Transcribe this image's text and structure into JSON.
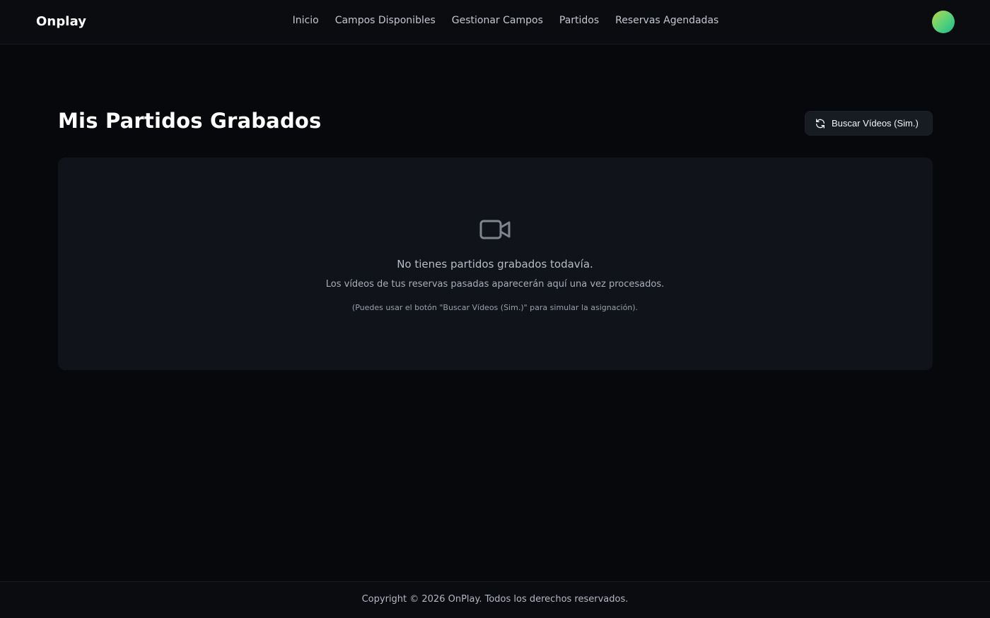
{
  "header": {
    "brand": "Onplay",
    "nav": [
      {
        "label": "Inicio"
      },
      {
        "label": "Campos Disponibles"
      },
      {
        "label": "Gestionar Campos"
      },
      {
        "label": "Partidos"
      },
      {
        "label": "Reservas Agendadas"
      }
    ],
    "avatar_icon": "user-avatar"
  },
  "main": {
    "title": "Mis Partidos Grabados",
    "sync_button": {
      "label": "Buscar Vídeos (Sim.)",
      "icon": "refresh-icon"
    },
    "empty_state": {
      "icon": "video-camera-icon",
      "title": "No tienes partidos grabados todavía.",
      "subtitle": "Los vídeos de tus reservas pasadas aparecerán aquí una vez procesados.",
      "hint": "(Puedes usar el botón \"Buscar Vídeos (Sim.)\" para simular la asignación)."
    }
  },
  "footer": {
    "copyright": "Copyright © 2026 OnPlay. Todos los derechos reservados."
  },
  "colors": {
    "background": "#07080b",
    "card": "#10131a",
    "button": "#171b22"
  }
}
